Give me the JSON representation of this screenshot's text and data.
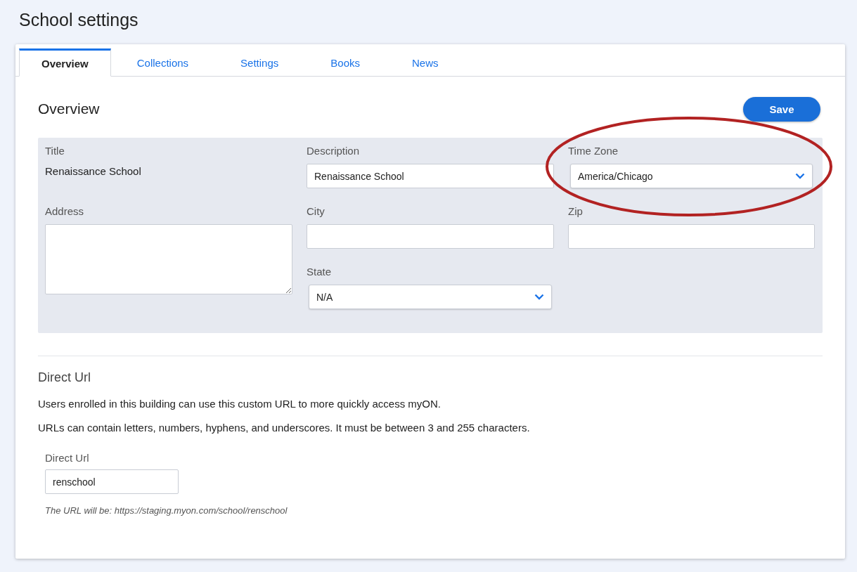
{
  "page_title": "School settings",
  "tabs": [
    {
      "label": "Overview",
      "selected": true
    },
    {
      "label": "Collections",
      "selected": false
    },
    {
      "label": "Settings",
      "selected": false
    },
    {
      "label": "Books",
      "selected": false
    },
    {
      "label": "News",
      "selected": false
    }
  ],
  "section_title": "Overview",
  "save_button": "Save",
  "fields": [
    {
      "kind": "static",
      "label": "Title",
      "value": "Renaissance School"
    },
    {
      "kind": "input",
      "label": "Description",
      "value": "Renaissance School"
    },
    {
      "kind": "select",
      "label": "Time Zone",
      "value": "America/Chicago",
      "highlighted": true
    },
    {
      "kind": "textarea",
      "label": "Address"
    },
    {
      "kind": "input",
      "label": "City"
    },
    {
      "kind": "input",
      "label": "Zip"
    },
    {
      "kind": "select",
      "label": "State",
      "value": "N/A",
      "highlighted": false
    }
  ],
  "direct_url": {
    "heading": "Direct Url",
    "paragraphs": [
      "Users enrolled in this building can use this custom URL to more quickly access myON.",
      "URLs can contain letters, numbers, hyphens, and underscores. It must be between 3 and 255 characters."
    ],
    "label": "Direct Url",
    "value": "renschool",
    "hint": "The URL will be: https://staging.myon.com/school/renschool"
  }
}
